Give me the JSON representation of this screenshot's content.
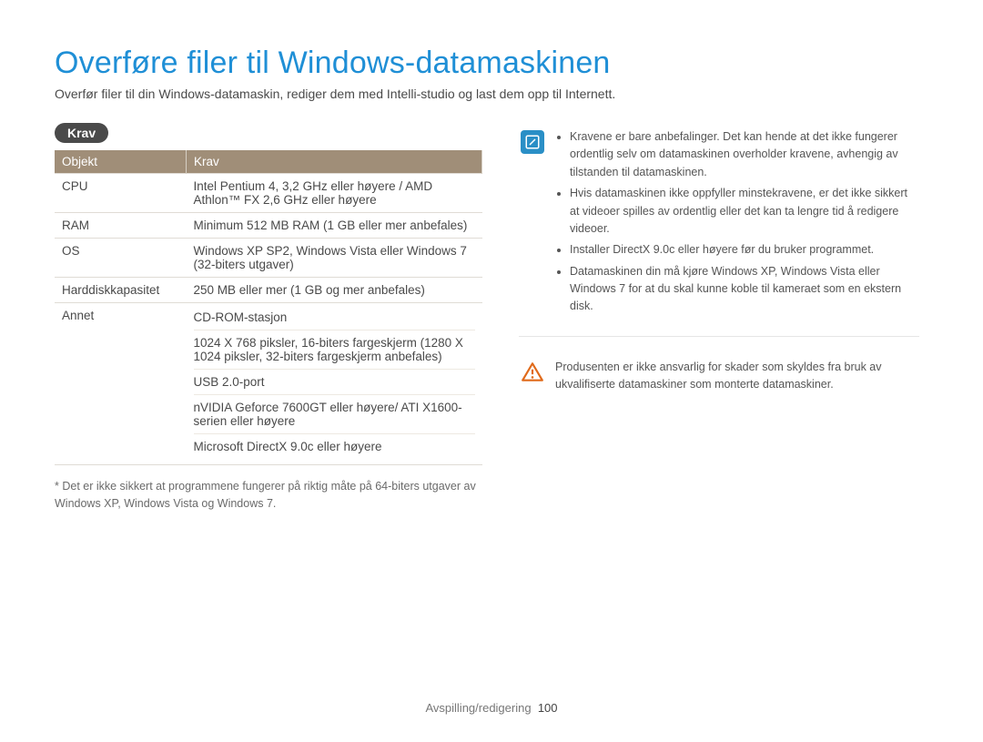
{
  "title": "Overføre filer til Windows-datamaskinen",
  "intro": "Overfør filer til din Windows-datamaskin, rediger dem med Intelli-studio og last dem opp til Internett.",
  "section_pill": "Krav",
  "table": {
    "header_col1": "Objekt",
    "header_col2": "Krav",
    "rows": {
      "cpu_label": "CPU",
      "cpu_val": "Intel Pentium 4, 3,2 GHz eller høyere / AMD Athlon™ FX 2,6 GHz eller høyere",
      "ram_label": "RAM",
      "ram_val": "Minimum 512 MB RAM (1 GB eller mer anbefales)",
      "os_label": "OS",
      "os_val": "Windows XP SP2, Windows Vista eller Windows 7 (32-biters utgaver)",
      "hdd_label": "Harddiskkapasitet",
      "hdd_val": "250 MB eller mer (1 GB og mer anbefales)",
      "other_label": "Annet",
      "other_1": "CD-ROM-stasjon",
      "other_2": "1024 X 768 piksler, 16-biters fargeskjerm (1280 X 1024 piksler, 32-biters fargeskjerm anbefales)",
      "other_3": "USB 2.0-port",
      "other_4": "nVIDIA Geforce 7600GT eller høyere/ ATI X1600-serien eller høyere",
      "other_5": "Microsoft DirectX 9.0c eller høyere"
    }
  },
  "footnote": "* Det er ikke sikkert at programmene fungerer på riktig måte på 64-biters utgaver av Windows XP, Windows Vista og Windows 7.",
  "info_notes": {
    "n1": "Kravene er bare anbefalinger. Det kan hende at det ikke fungerer ordentlig selv om datamaskinen overholder kravene, avhengig av tilstanden til datamaskinen.",
    "n2": "Hvis datamaskinen ikke oppfyller minstekravene, er det ikke sikkert at videoer spilles av ordentlig eller det kan ta lengre tid å redigere videoer.",
    "n3": "Installer DirectX 9.0c eller høyere før du bruker programmet.",
    "n4": "Datamaskinen din må kjøre Windows XP, Windows Vista eller Windows 7 for at du skal kunne koble til kameraet som en ekstern disk."
  },
  "warning_note": "Produsenten er ikke ansvarlig for skader som skyldes fra bruk av ukvalifiserte datamaskiner som monterte datamaskiner.",
  "footer_section": "Avspilling/redigering",
  "footer_page": "100"
}
